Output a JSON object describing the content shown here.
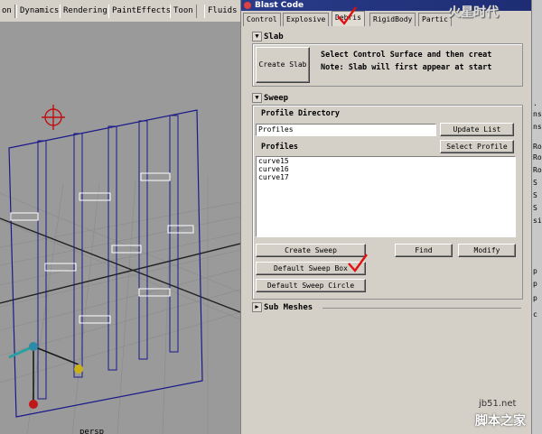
{
  "shelf": {
    "tabs": [
      "on",
      "Dynamics",
      "Rendering",
      "PaintEffects",
      "Toon",
      "Fluids"
    ]
  },
  "viewport": {
    "label": "persp"
  },
  "window": {
    "title": "Blast Code",
    "tabs": [
      "Control",
      "Explosive",
      "Debris",
      "RigidBody",
      "Partic"
    ],
    "active_tab": "Debris",
    "slab": {
      "header": "Slab",
      "button": "Create Slab",
      "line1": "Select Control Surface and then creat",
      "line2": "Note: Slab will first appear at start"
    },
    "sweep": {
      "header": "Sweep",
      "profile_directory_label": "Profile Directory",
      "profile_directory_value": "Profiles",
      "update_list_button": "Update List",
      "profiles_label": "Profiles",
      "select_profile_button": "Select Profile",
      "profiles": [
        "curve15",
        "curve16",
        "curve17"
      ],
      "create_sweep_button": "Create Sweep",
      "find_button": "Find",
      "modify_button": "Modify",
      "default_sweep_box_button": "Default Sweep Box",
      "default_sweep_circle_button": "Default Sweep Circle"
    },
    "sub_meshes": {
      "header": "Sub Meshes"
    }
  },
  "right_panel": {
    "items": [
      ".",
      "ns:",
      "ns:",
      "Ro",
      "Ro",
      "Ro",
      "S",
      "S",
      "S",
      "sil",
      "p",
      "p",
      "p",
      "c"
    ]
  },
  "watermarks": {
    "top": "火星时代",
    "url": "jb51.net",
    "cn": "脚本之家"
  },
  "colors": {
    "titlebar": "#1d2c72",
    "viewport_bg": "#9a9a9a",
    "wire": "#1a1a8a",
    "check_mark": "#e01010"
  }
}
